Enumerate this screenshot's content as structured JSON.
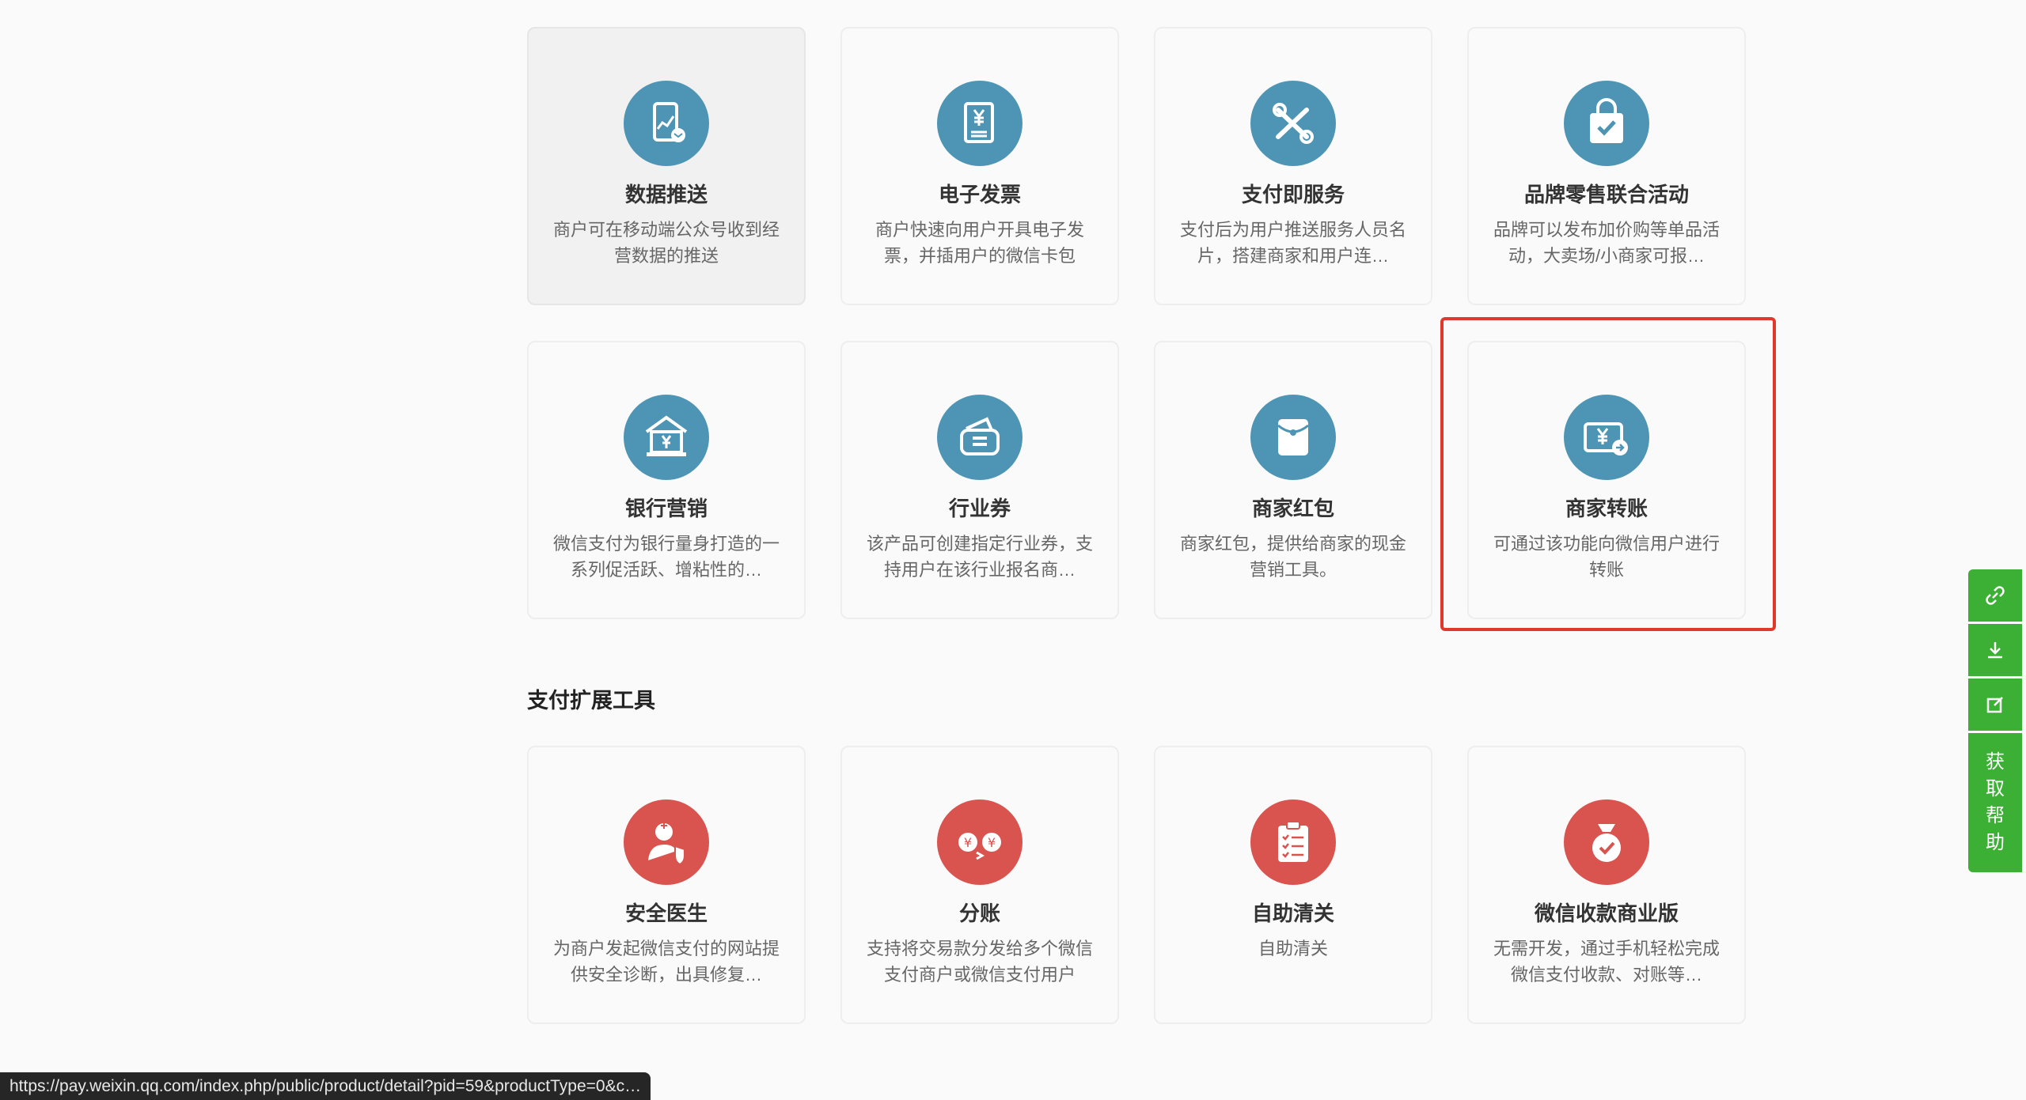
{
  "colors": {
    "blue_icon": "#4e95b5",
    "red_icon": "#d9534f",
    "accent_green": "#3cb034",
    "highlight_red": "#e0392b"
  },
  "cards": [
    {
      "title": "数据推送",
      "desc": "商户可在移动端公众号收到经营数据的推送",
      "icon": "data-push-icon"
    },
    {
      "title": "电子发票",
      "desc": "商户快速向用户开具电子发票，并插用户的微信卡包",
      "icon": "invoice-icon"
    },
    {
      "title": "支付即服务",
      "desc": "支付后为用户推送服务人员名片，搭建商家和用户连…",
      "icon": "pay-service-icon"
    },
    {
      "title": "品牌零售联合活动",
      "desc": "品牌可以发布加价购等单品活动，大卖场/小商家可报…",
      "icon": "shopping-bag-icon"
    },
    {
      "title": "银行营销",
      "desc": "微信支付为银行量身打造的一系列促活跃、增粘性的…",
      "icon": "bank-icon"
    },
    {
      "title": "行业券",
      "desc": "该产品可创建指定行业券，支持用户在该行业报名商…",
      "icon": "wallet-icon"
    },
    {
      "title": "商家红包",
      "desc": "商家红包，提供给商家的现金营销工具。",
      "icon": "red-packet-icon"
    },
    {
      "title": "商家转账",
      "desc": "可通过该功能向微信用户进行转账",
      "icon": "transfer-icon"
    }
  ],
  "section": {
    "title": "支付扩展工具"
  },
  "tools": [
    {
      "title": "安全医生",
      "desc": "为商户发起微信支付的网站提供安全诊断，出具修复…",
      "icon": "security-doctor-icon"
    },
    {
      "title": "分账",
      "desc": "支持将交易款分发给多个微信支付商户或微信支付用户",
      "icon": "split-payment-icon"
    },
    {
      "title": "自助清关",
      "desc": "自助清关",
      "icon": "clipboard-icon"
    },
    {
      "title": "微信收款商业版",
      "desc": "无需开发，通过手机轻松完成微信支付收款、对账等…",
      "icon": "money-bag-icon"
    }
  ],
  "sidebar": {
    "help_chars": [
      "获",
      "取",
      "帮",
      "助"
    ],
    "icons": [
      "link-icon",
      "download-icon",
      "edit-icon"
    ]
  },
  "status_url": "https://pay.weixin.qq.com/index.php/public/product/detail?pid=59&productType=0&c…"
}
